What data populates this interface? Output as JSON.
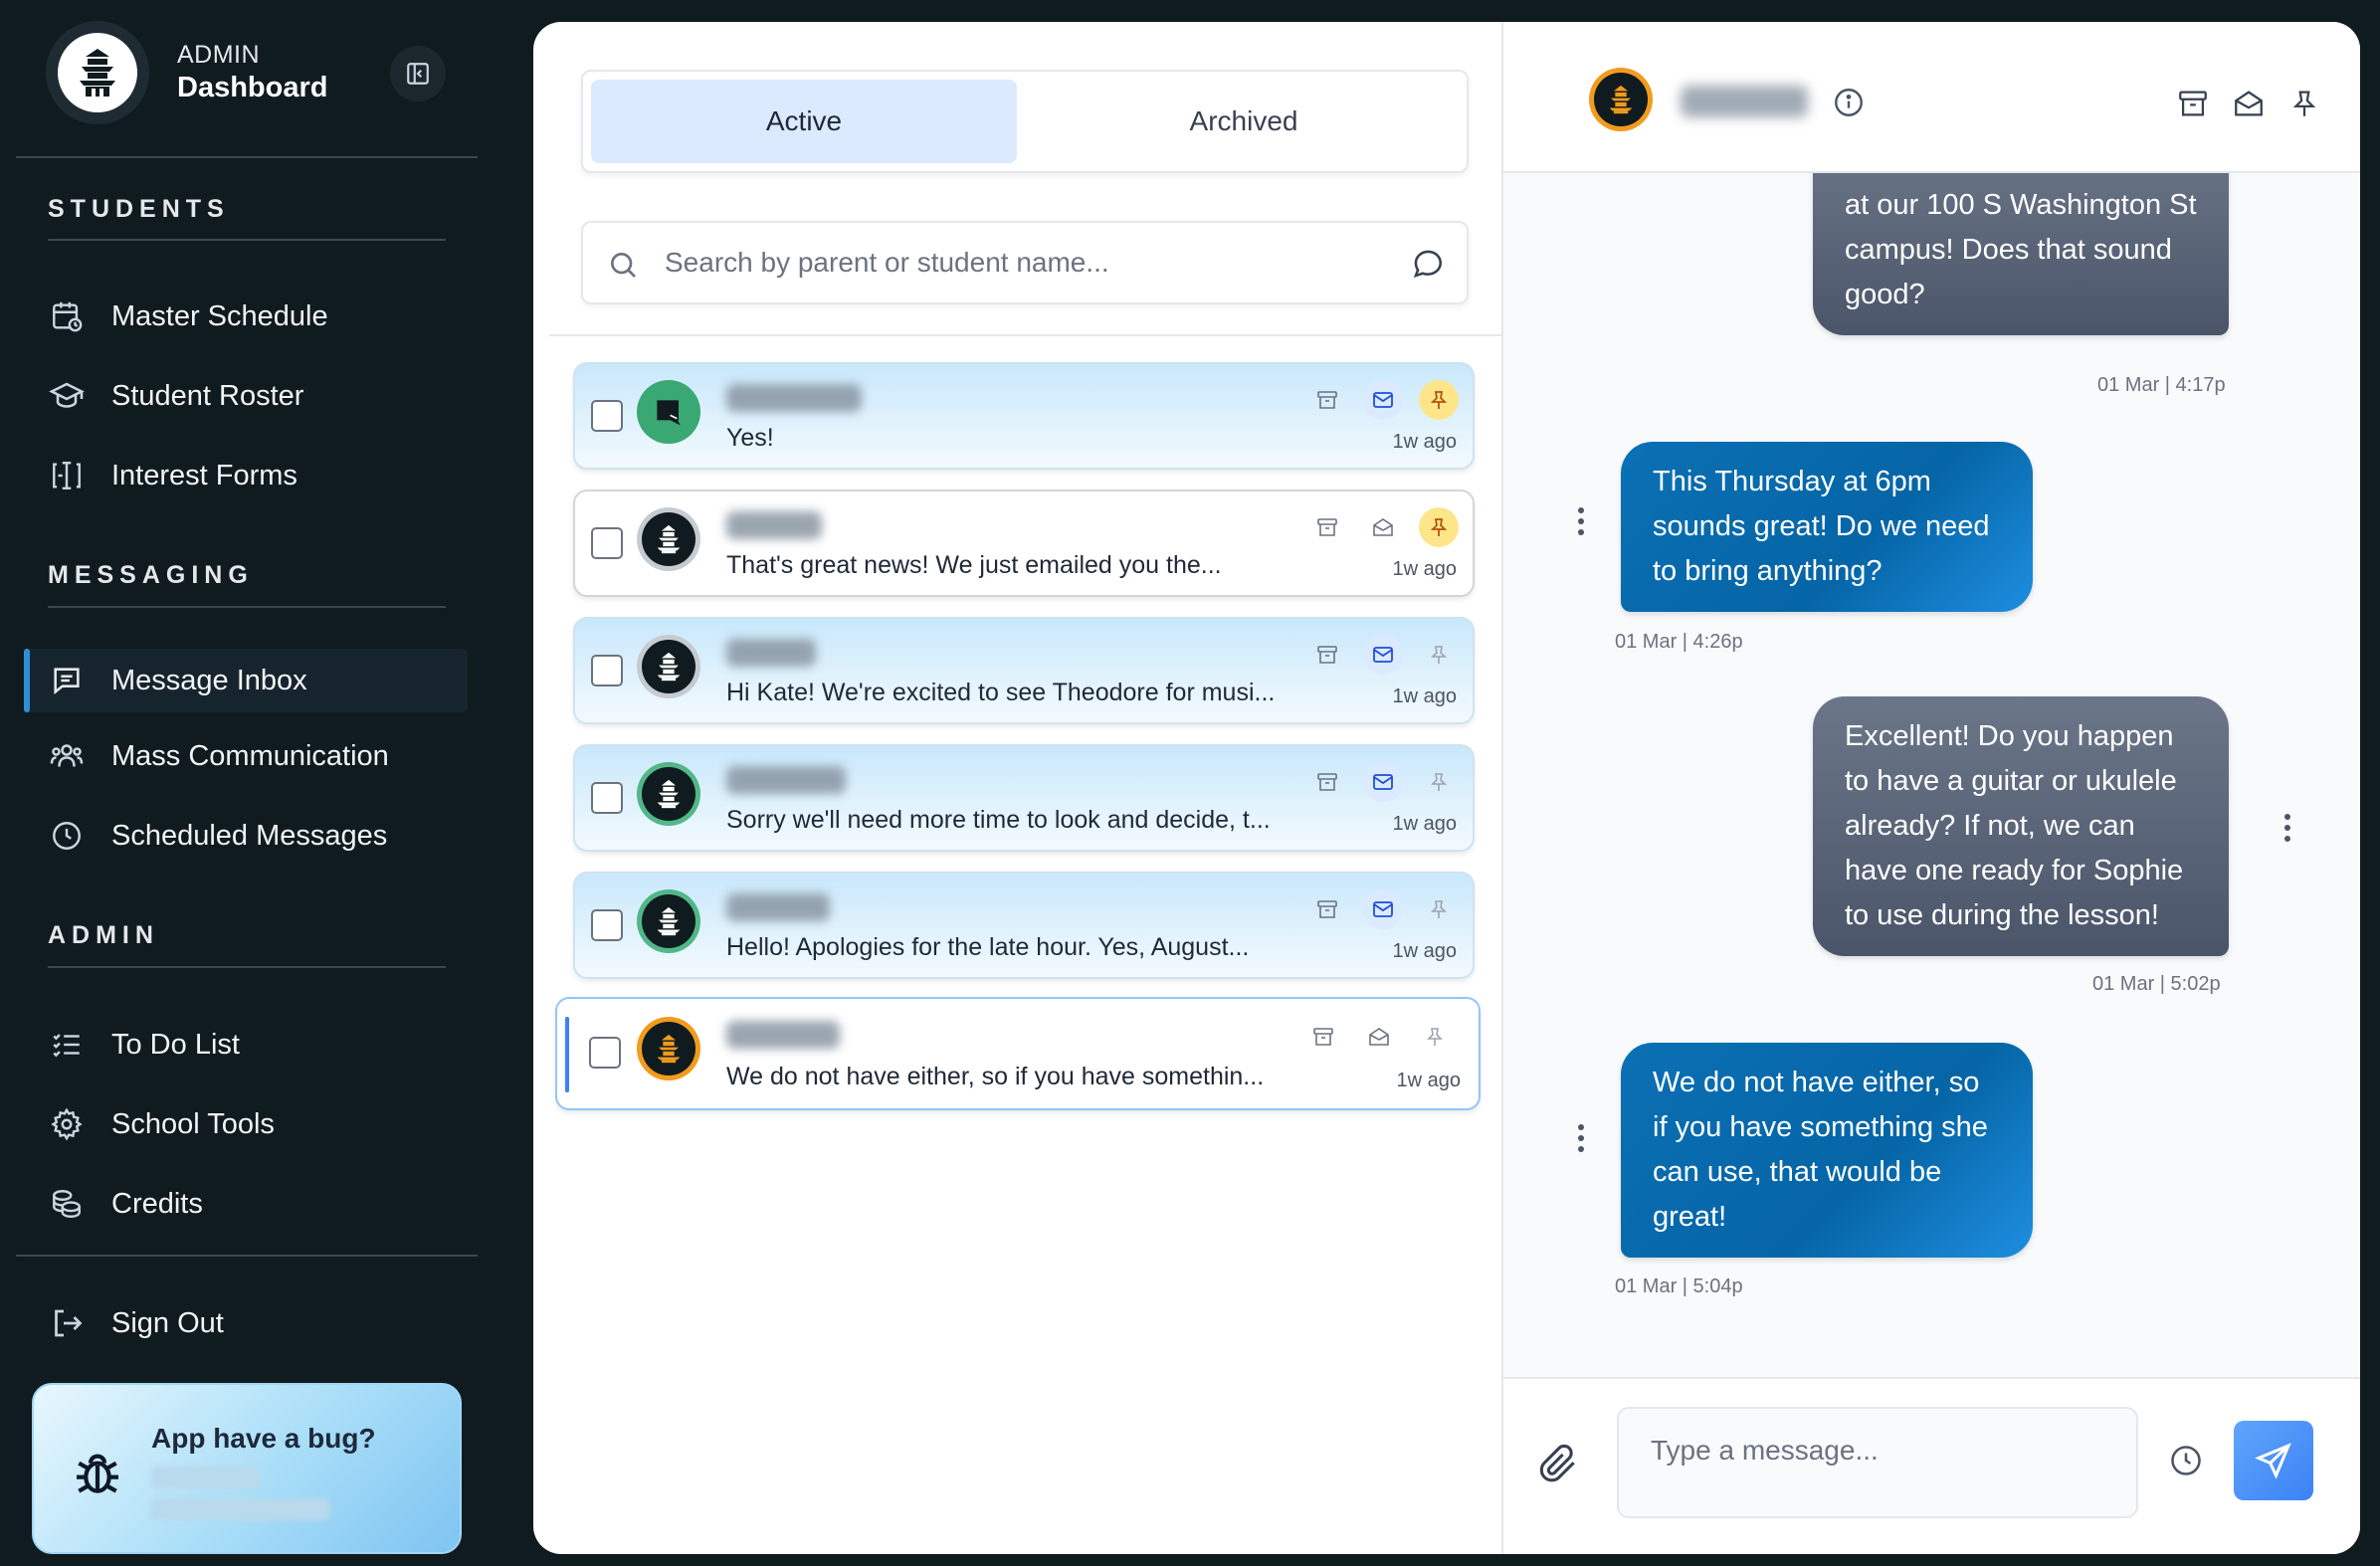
{
  "sidebar": {
    "brand_sub": "ADMIN",
    "brand_title": "Dashboard",
    "sections": {
      "students": "STUDENTS",
      "messaging": "MESSAGING",
      "admin": "ADMIN"
    },
    "items": {
      "master_schedule": "Master Schedule",
      "student_roster": "Student Roster",
      "interest_forms": "Interest Forms",
      "message_inbox": "Message Inbox",
      "mass_communication": "Mass Communication",
      "scheduled_messages": "Scheduled Messages",
      "todo": "To Do List",
      "school_tools": "School Tools",
      "credits": "Credits",
      "sign_out": "Sign Out"
    },
    "active_item": "message_inbox",
    "bug_card": {
      "title": "App have a bug?"
    }
  },
  "inbox": {
    "tabs": {
      "active": "Active",
      "archived": "Archived"
    },
    "selected_tab": "active",
    "search_placeholder": "Search by parent or student name...",
    "conversations": [
      {
        "preview": "Yes!",
        "time": "1w ago",
        "unread": true,
        "pinned": true
      },
      {
        "preview": "That's great news! We just emailed you the...",
        "time": "1w ago",
        "unread": false,
        "pinned": true
      },
      {
        "preview": "Hi Kate! We're excited to see Theodore for musi...",
        "time": "1w ago",
        "unread": true,
        "pinned": false
      },
      {
        "preview": "Sorry we'll need more time to look and decide, t...",
        "time": "1w ago",
        "unread": true,
        "pinned": false
      },
      {
        "preview": "Hello! Apologies for the late hour. Yes, August...",
        "time": "1w ago",
        "unread": true,
        "pinned": false
      },
      {
        "preview": "We do not have either, so if you have somethin...",
        "time": "1w ago",
        "unread": false,
        "pinned": false,
        "selected": true
      }
    ]
  },
  "chat": {
    "messages": [
      {
        "direction": "out",
        "text": "at our 100 S Washington St campus! Does that sound good?",
        "time": "01 Mar | 4:17p"
      },
      {
        "direction": "in",
        "text": "This Thursday at 6pm sounds great! Do we need to bring anything?",
        "time": "01 Mar | 4:26p"
      },
      {
        "direction": "out",
        "text": "Excellent! Do you happen to have a guitar or ukulele already? If not, we can have one ready for Sophie to use during the lesson!",
        "time": "01 Mar | 5:02p"
      },
      {
        "direction": "in",
        "text": "We do not have either, so if you have something she can use, that would be great!",
        "time": "01 Mar | 5:04p"
      }
    ],
    "composer_placeholder": "Type a message..."
  },
  "colors": {
    "sidebar_bg": "#0f1b1f",
    "accent": "#3b82f6",
    "incoming_bubble": "#0b70b4",
    "outgoing_bubble": "#5b6578",
    "pin_active": "#fde68a"
  }
}
